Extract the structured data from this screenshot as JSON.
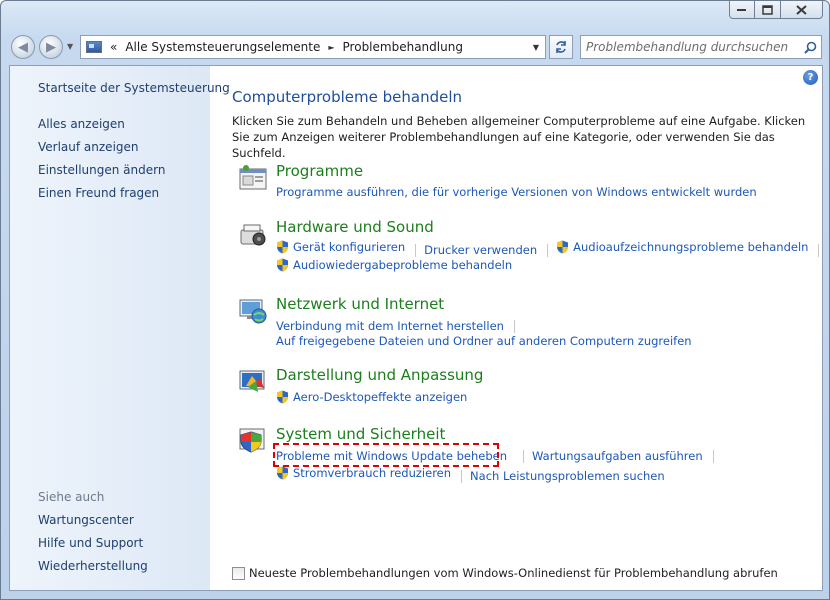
{
  "window": {
    "caption": {
      "minimize": "▬",
      "maximize": "□",
      "close": "✕"
    }
  },
  "nav": {
    "back": "◀",
    "forward": "▶",
    "breadcrumb": {
      "overflow": "«",
      "items": [
        "Alle Systemsteuerungselemente",
        "Problembehandlung"
      ],
      "separator": "►"
    },
    "search_placeholder": "Problembehandlung durchsuchen"
  },
  "sidebar": {
    "home": "Startseite der Systemsteuerung",
    "links": [
      "Alles anzeigen",
      "Verlauf anzeigen",
      "Einstellungen ändern",
      "Einen Freund fragen"
    ],
    "see_also_heading": "Siehe auch",
    "see_also": [
      "Wartungscenter",
      "Hilfe und Support",
      "Wiederherstellung"
    ]
  },
  "main": {
    "title": "Computerprobleme behandeln",
    "intro": "Klicken Sie zum Behandeln und Beheben allgemeiner Computerprobleme auf eine Aufgabe. Klicken Sie zum Anzeigen weiterer Problembehandlungen auf eine Kategorie, oder verwenden Sie das Suchfeld.",
    "categories": [
      {
        "title": "Programme",
        "icon": "programs-icon",
        "links": [
          {
            "label": "Programme ausführen, die für vorherige Versionen von Windows entwickelt wurden",
            "shield": false
          }
        ]
      },
      {
        "title": "Hardware und Sound",
        "icon": "hardware-sound-icon",
        "links": [
          {
            "label": "Gerät konfigurieren",
            "shield": true
          },
          {
            "label": "Drucker verwenden",
            "shield": false
          },
          {
            "label": "Audioaufzeichnungsprobleme behandeln",
            "shield": true
          },
          {
            "label": "Audiowiedergabeprobleme behandeln",
            "shield": true
          }
        ]
      },
      {
        "title": "Netzwerk und Internet",
        "icon": "network-icon",
        "links": [
          {
            "label": "Verbindung mit dem Internet herstellen",
            "shield": false
          },
          {
            "label": "Auf freigegebene Dateien und Ordner auf anderen Computern zugreifen",
            "shield": false
          }
        ]
      },
      {
        "title": "Darstellung und Anpassung",
        "icon": "appearance-icon",
        "links": [
          {
            "label": "Aero-Desktopeffekte anzeigen",
            "shield": true
          }
        ]
      },
      {
        "title": "System und Sicherheit",
        "icon": "security-icon",
        "links": [
          {
            "label": "Probleme mit Windows Update beheben",
            "shield": false
          },
          {
            "label": "Wartungsaufgaben ausführen",
            "shield": false
          },
          {
            "label": "Stromverbrauch reduzieren",
            "shield": true
          },
          {
            "label": "Nach Leistungsproblemen suchen",
            "shield": false
          }
        ]
      }
    ],
    "online_checkbox": {
      "label": "Neueste Problembehandlungen vom Windows-Onlinedienst für Problembehandlung abrufen",
      "checked": false
    }
  },
  "colors": {
    "link": "#1d58b8",
    "category_title": "#1d7e1d",
    "main_title": "#1e4e9c",
    "highlight": "#e00000"
  }
}
